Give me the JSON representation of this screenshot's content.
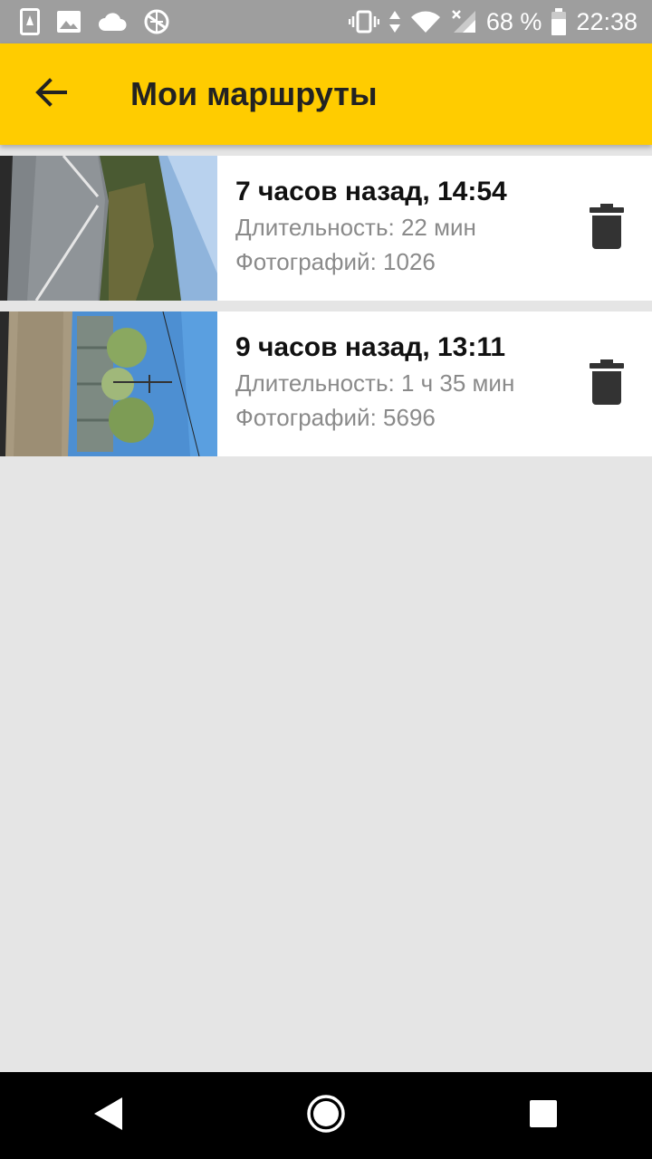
{
  "status_bar": {
    "battery": "68 %",
    "time": "22:38"
  },
  "app_bar": {
    "title": "Мои маршруты"
  },
  "routes": [
    {
      "title": "7 часов назад, 14:54",
      "duration": "Длительность: 22 мин",
      "photos": "Фотографий: 1026"
    },
    {
      "title": "9 часов назад, 13:11",
      "duration": "Длительность: 1 ч 35 мин",
      "photos": "Фотографий: 5696"
    }
  ],
  "colors": {
    "app_bar": "#ffcc00",
    "status_bar": "#9e9e9e",
    "background": "#e5e5e5"
  },
  "icons": {
    "back": "arrow-back-icon",
    "delete": "trash-icon",
    "nav_back": "triangle-back-icon",
    "nav_home": "circle-home-icon",
    "nav_recents": "square-recents-icon"
  }
}
